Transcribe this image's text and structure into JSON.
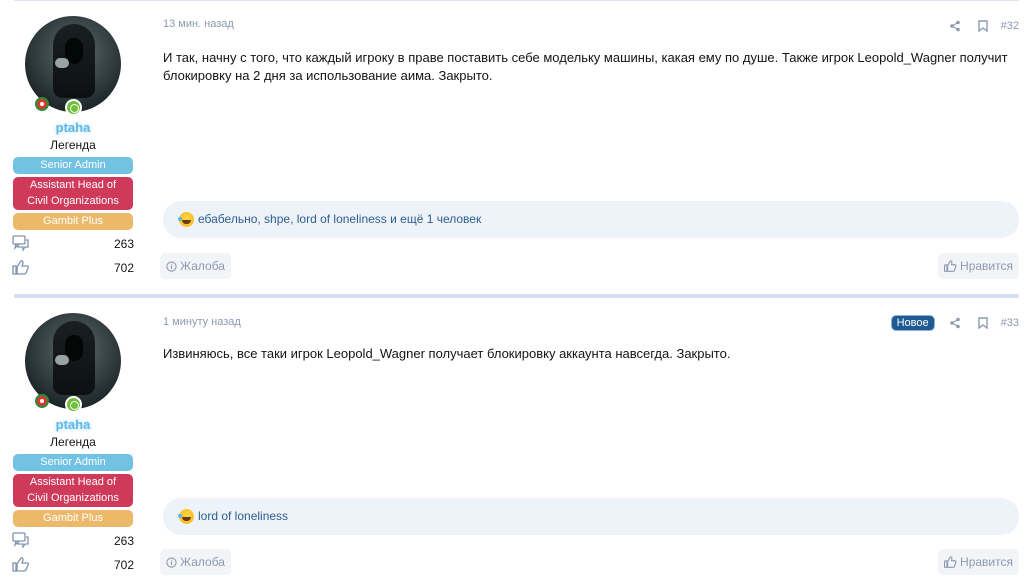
{
  "posts": [
    {
      "user": {
        "name": "ptaha",
        "title": "Легенда",
        "banners": [
          "Senior Admin",
          "Assistant Head of Civil Organizations",
          "Gambit Plus"
        ],
        "banner_lines": [
          "Assistant Head of",
          "Civil Organizations"
        ],
        "messages_icon": "speech-bubbles-icon",
        "messages": "263",
        "likes_icon": "thumbs-up-icon",
        "likes": "702"
      },
      "date": "13 мин. назад",
      "number": "#32",
      "is_new": false,
      "text_lines": [
        "И так, начну с того, что каждый игроку в праве поставить себе модельку машины, какая ему по душе. Также игрок Leopold_Wagner получит",
        "блокировку на 2 дня за использование аима. Закрыто."
      ],
      "reactions": "ебабельно, shpe, lord of loneliness и ещё 1 человек",
      "report_label": "Жалоба",
      "like_label": "Нравится"
    },
    {
      "user": {
        "name": "ptaha",
        "title": "Легенда",
        "banners": [
          "Senior Admin",
          "Assistant Head of Civil Organizations",
          "Gambit Plus"
        ],
        "banner_lines": [
          "Assistant Head of",
          "Civil Organizations"
        ],
        "messages_icon": "speech-bubbles-icon",
        "messages": "263",
        "likes_icon": "thumbs-up-icon",
        "likes": "702"
      },
      "date": "1 минуту назад",
      "number": "#33",
      "is_new": true,
      "new_label": "Новое",
      "text_lines": [
        "Извиняюсь, все таки игрок Leopold_Wagner получает блокировку аккаунта навсегда. Закрыто."
      ],
      "reactions": "lord of loneliness",
      "report_label": "Жалоба",
      "like_label": "Нравится"
    }
  ],
  "colors": {
    "username": "#5fb7e8",
    "senior_admin": "#72c2e3",
    "assistant_head": "#cf3a5b",
    "gambit_plus": "#ecb96a",
    "new_badge": "#1f5a93",
    "muted": "#8c9ab0",
    "reaction_bg": "#eef3fa",
    "separator": "#d3e0f1"
  }
}
